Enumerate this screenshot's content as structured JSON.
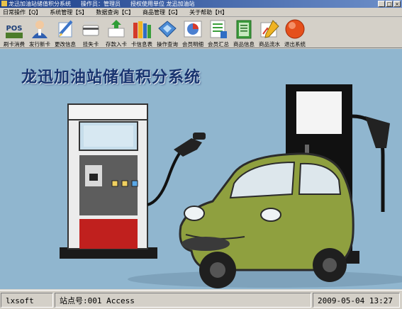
{
  "window": {
    "title": "龙迅加油站储值积分系统",
    "operator": "操作员：管理员",
    "licensee": "授权使用单位 龙迅加油站"
  },
  "menu": [
    "日常操作【Q】",
    "系统管理【S】",
    "数据查询【C】",
    "商品管理【G】",
    "关于帮助【H】"
  ],
  "toolbar": [
    {
      "label": "刷卡消费",
      "icon": "pos-icon"
    },
    {
      "label": "发行新卡",
      "icon": "user-icon"
    },
    {
      "label": "更改信息",
      "icon": "edit-icon"
    },
    {
      "label": "挂失卡",
      "icon": "card-lost-icon"
    },
    {
      "label": "存款入卡",
      "icon": "deposit-icon"
    },
    {
      "label": "卡信息表",
      "icon": "books-icon"
    },
    {
      "label": "操作查询",
      "icon": "query-icon"
    },
    {
      "label": "会员明细",
      "icon": "chart-icon"
    },
    {
      "label": "会员汇总",
      "icon": "summary-icon"
    },
    {
      "label": "商品信息",
      "icon": "notebook-icon"
    },
    {
      "label": "商品流水",
      "icon": "drawing-icon"
    },
    {
      "label": "退出系统",
      "icon": "exit-icon"
    }
  ],
  "banner": {
    "heading": "龙迅加油站储值积分系统"
  },
  "status": {
    "user": "lxsoft",
    "station": "站点号:001 Access",
    "datetime": "2009-05-04 13:27"
  },
  "colors": {
    "background": "#90b6cf",
    "pump_red": "#c0201e",
    "car": "#8fa03f",
    "heading": "#1a3570"
  }
}
